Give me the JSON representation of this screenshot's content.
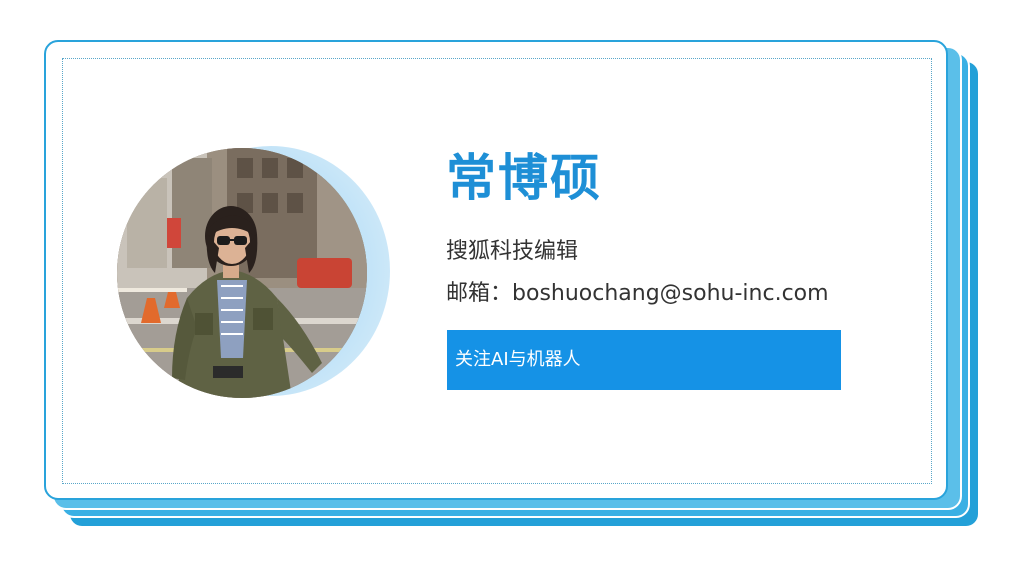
{
  "profile": {
    "name": "常博硕",
    "role": "搜狐科技编辑",
    "email_label": "邮箱：",
    "email": "boshuochang@sohu-inc.com",
    "follow_label": "关注AI与机器人"
  },
  "colors": {
    "accent": "#1e8fd6",
    "follow_bar": "#1592e6",
    "card_border": "#29a3db",
    "stack": "#2aa6dd"
  },
  "avatar": {
    "description_icon": "profile-photo"
  }
}
